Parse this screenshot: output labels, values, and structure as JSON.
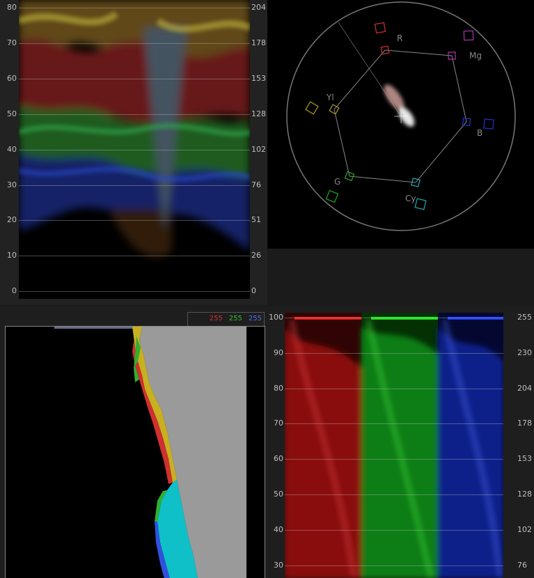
{
  "waveform": {
    "left_ticks": [
      "80",
      "70",
      "60",
      "50",
      "40",
      "30",
      "20",
      "10",
      "0"
    ],
    "right_ticks": [
      "204",
      "178",
      "153",
      "128",
      "102",
      "76",
      "51",
      "26",
      "0"
    ]
  },
  "vectorscope": {
    "targets": [
      "R",
      "Mg",
      "B",
      "Cy",
      "G",
      "Yl"
    ]
  },
  "histogram": {
    "legend": {
      "red": "255",
      "green": "255",
      "blue": "255"
    }
  },
  "parade": {
    "left_ticks": [
      "100",
      "90",
      "80",
      "70",
      "60",
      "50",
      "40",
      "30"
    ],
    "right_ticks": [
      "255",
      "230",
      "204",
      "178",
      "153",
      "128",
      "102",
      "76"
    ]
  },
  "colors": {
    "red": "#d03030",
    "green": "#30c030",
    "blue": "#3050e0",
    "yellow": "#c8b020",
    "cyan": "#10c0c8",
    "gray": "#9a9a9a"
  }
}
